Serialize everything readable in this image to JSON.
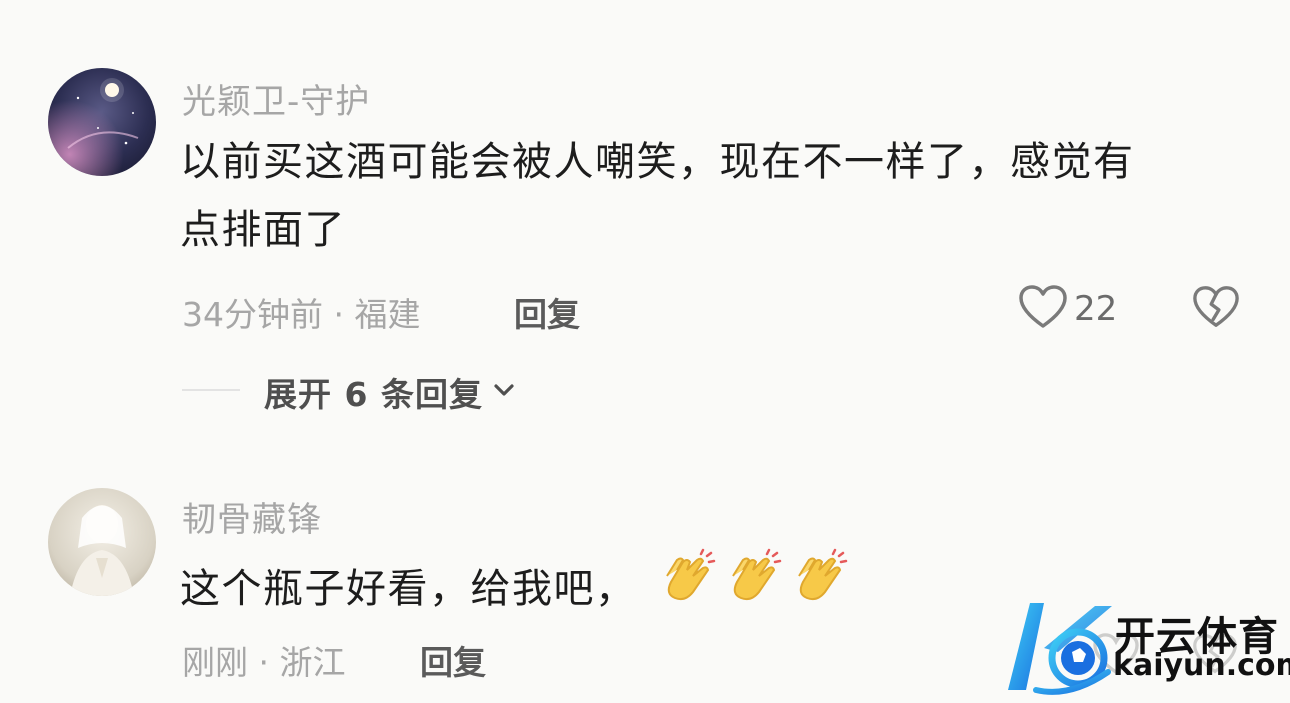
{
  "comments": [
    {
      "username": "光颖卫-守护",
      "content_line1": "以前买这酒可能会被人嘲笑，现在不一样了，感觉有",
      "content_line2": "点排面了",
      "time_location": "34分钟前 · 福建",
      "reply_label": "回复",
      "like_count": "22",
      "expand_label": "展开 6 条回复"
    },
    {
      "username": "韧骨藏锋",
      "content": "这个瓶子好看，给我吧，",
      "emoji": [
        "clapping-hands",
        "clapping-hands",
        "clapping-hands"
      ],
      "time_location": "刚刚 · 浙江",
      "reply_label": "回复"
    }
  ],
  "watermark": {
    "name": "开云体育",
    "domain": "kaiyun.com"
  }
}
